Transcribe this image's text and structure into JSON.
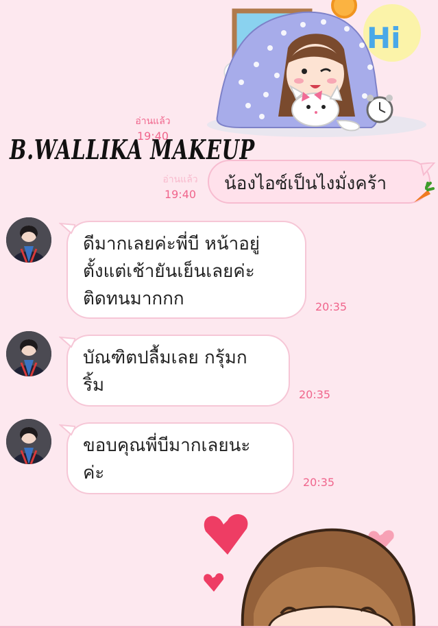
{
  "header": {
    "brand": "B.WALLIKA MAKEUP",
    "read_status": "อ่านแล้ว",
    "first_time": "19:40",
    "faded_read": "อ่านแล้ว",
    "second_time": "19:40"
  },
  "sticker_top": {
    "label": "Hi"
  },
  "messages": [
    {
      "side": "outgoing",
      "text": "น้องไอซ์เป็นไงมั่งคร้า",
      "time": "19:40",
      "emoji": "carrot"
    },
    {
      "side": "incoming",
      "lines": [
        "ดีมากเลยค่ะพี่บี หน้าอยู่",
        "ตั้งแต่เช้ายันเย็นเลยค่ะ",
        "ติดทนมากกก"
      ],
      "time": "20:35"
    },
    {
      "side": "incoming",
      "lines": [
        "บัณฑิตปลื้มเลย กรุ้มก",
        "ริ้ม"
      ],
      "time": "20:35"
    },
    {
      "side": "incoming",
      "lines": [
        "ขอบคุณพี่บีมากเลยนะ",
        "ค่ะ"
      ],
      "time": "20:35"
    }
  ],
  "colors": {
    "background": "#fde8ef",
    "accent": "#f0658c",
    "bubble_out": "#ffe1eb",
    "bubble_border": "#f6c6d6"
  }
}
